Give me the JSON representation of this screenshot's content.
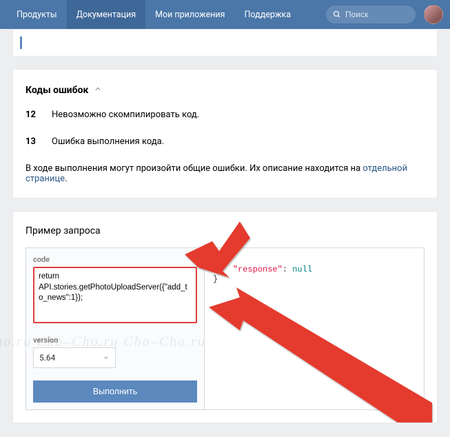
{
  "nav": {
    "items": [
      "Продукты",
      "Документация",
      "Мои приложения",
      "Поддержка"
    ],
    "active_index": 1,
    "search_placeholder": "Поиск"
  },
  "errors_section": {
    "title": "Коды ошибок",
    "rows": [
      {
        "code": "12",
        "text": "Невозможно скомпилировать код."
      },
      {
        "code": "13",
        "text": "Ошибка выполнения кода."
      }
    ],
    "common_note_prefix": "В ходе выполнения могут произойти общие ошибки. Их описание находится на ",
    "common_note_link": "отдельной странице",
    "common_note_suffix": "."
  },
  "example_section": {
    "title": "Пример запроса",
    "code_label": "code",
    "code_value": "return API.stories.getPhotoUploadServer({\"add_to_news\":1});",
    "version_label": "version",
    "version_value": "5.64",
    "execute_label": "Выполнить",
    "response_raw": "{\n    \"response\": null\n}",
    "response_key": "\"response\"",
    "response_value": "null"
  },
  "watermark": "Сho–Сho.ru Сho–Сho.ru Сho–Сho.ru Сho–Сho.ru Сho–Сho.ru"
}
